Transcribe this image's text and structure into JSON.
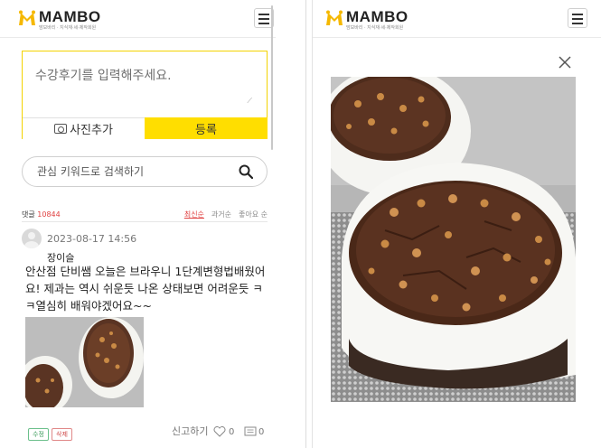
{
  "brand": {
    "logo_text": "MAMBO",
    "logo_sub": "맘보바리 · 지식재·세·제작회원",
    "colors": {
      "accent": "#ffde00",
      "red": "#e04040",
      "border_yellow": "#f3d300"
    }
  },
  "left": {
    "menu_icon": "hamburger-icon",
    "review": {
      "placeholder": "수강후기를 입력해주세요.",
      "photo_label": "사진추가",
      "submit_label": "등록"
    },
    "search": {
      "placeholder": "관심 키워드로 검색하기",
      "icon": "search-icon"
    },
    "comments": {
      "label": "댓글",
      "count": "10844",
      "sorts": [
        "최신순",
        "과거순",
        "좋아요 순"
      ],
      "active_sort": "최신순"
    },
    "post": {
      "date": "2023-08-17 14:56",
      "author": "장이슬",
      "body": "안산점 단비쌤 오늘은 브라우니 1단계변형법배웠어요! 제과는 역시 쉬운듯 나온 상태보면 어려운듯 ㅋㅋ열심히 배워야겠어요~~",
      "edit_label": "수정",
      "delete_label": "삭제",
      "report_label": "신고하기",
      "like_count": "0",
      "reply_count": "0"
    }
  },
  "right": {
    "close_icon": "close-icon",
    "photo_subject": "walnut-brownie-photo"
  }
}
